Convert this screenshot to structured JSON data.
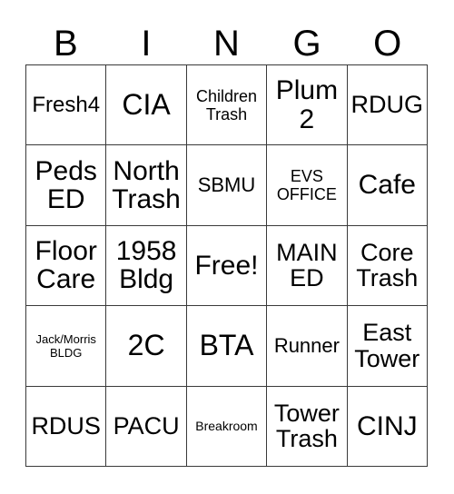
{
  "card": {
    "header_letters": [
      "B",
      "I",
      "N",
      "G",
      "O"
    ],
    "columns": [
      {
        "letter": "B",
        "cells": [
          {
            "text": "Fresh4",
            "size": "xl"
          },
          {
            "text": "Peds\nED",
            "size": "3xl"
          },
          {
            "text": "Floor\nCare",
            "size": "3xl"
          },
          {
            "text": "Jack/Morris\nBLDG",
            "size": "xs"
          },
          {
            "text": "RDUS",
            "size": "2xl"
          }
        ]
      },
      {
        "letter": "I",
        "cells": [
          {
            "text": "CIA",
            "size": "4xl"
          },
          {
            "text": "North\nTrash",
            "size": "3xl"
          },
          {
            "text": "1958\nBldg",
            "size": "3xl"
          },
          {
            "text": "2C",
            "size": "4xl"
          },
          {
            "text": "PACU",
            "size": "2xl"
          }
        ]
      },
      {
        "letter": "N",
        "cells": [
          {
            "text": "Children\nTrash",
            "size": "md"
          },
          {
            "text": "SBMU",
            "size": "lg"
          },
          {
            "text": "Free!",
            "size": "3xl"
          },
          {
            "text": "BTA",
            "size": "4xl"
          },
          {
            "text": "Breakroom",
            "size": "sm"
          }
        ]
      },
      {
        "letter": "G",
        "cells": [
          {
            "text": "Plum\n2",
            "size": "3xl"
          },
          {
            "text": "EVS\nOFFICE",
            "size": "md"
          },
          {
            "text": "MAIN\nED",
            "size": "2xl"
          },
          {
            "text": "Runner",
            "size": "lg"
          },
          {
            "text": "Tower\nTrash",
            "size": "2xl"
          }
        ]
      },
      {
        "letter": "O",
        "cells": [
          {
            "text": "RDUG",
            "size": "2xl"
          },
          {
            "text": "Cafe",
            "size": "3xl"
          },
          {
            "text": "Core\nTrash",
            "size": "2xl"
          },
          {
            "text": "East\nTower",
            "size": "2xl"
          },
          {
            "text": "CINJ",
            "size": "3xl"
          }
        ]
      }
    ],
    "free_space": {
      "row": 2,
      "column": 2,
      "label": "Free!"
    },
    "colors": {
      "background": "#ffffff",
      "text": "#000000",
      "border": "#3a3a3a"
    }
  }
}
